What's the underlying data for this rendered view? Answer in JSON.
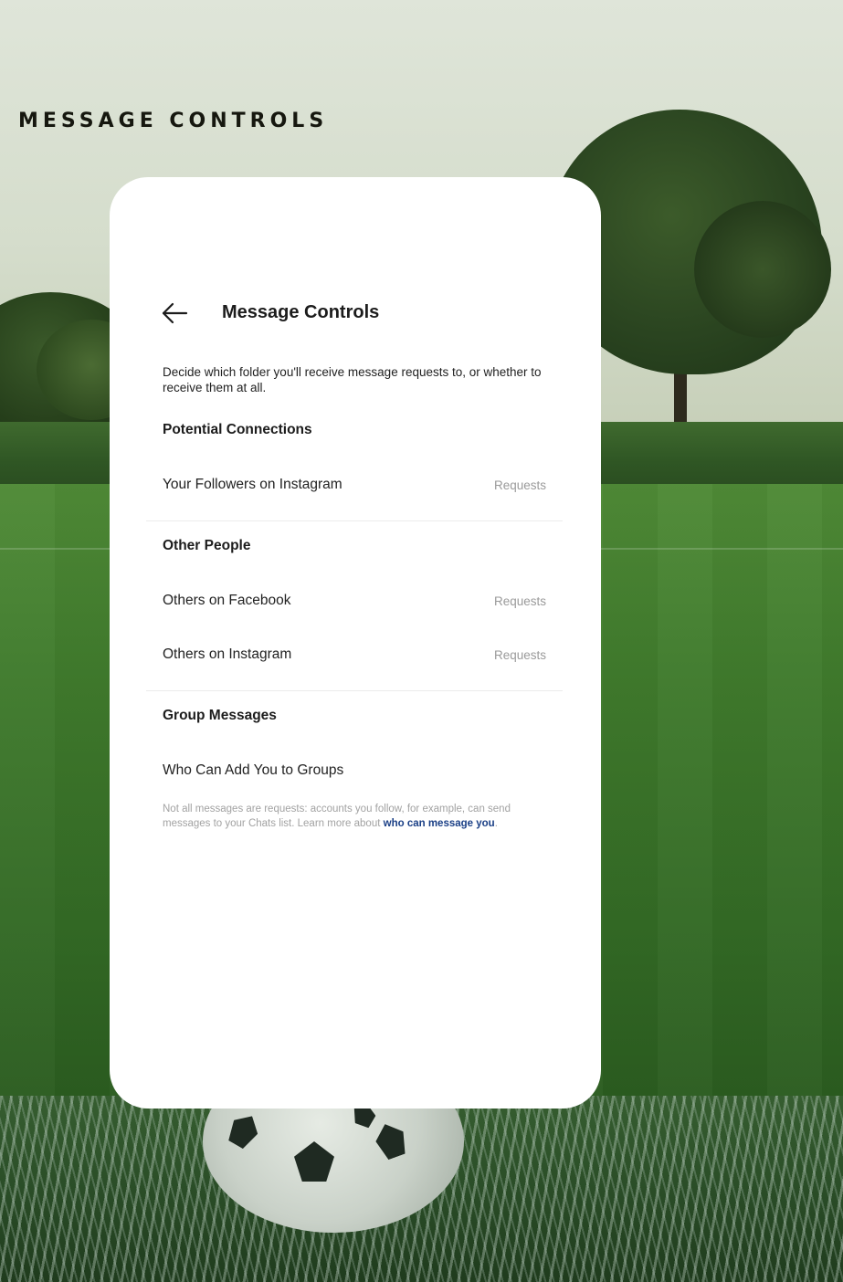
{
  "page_heading": "MESSAGE CONTROLS",
  "screen": {
    "back_icon": "arrow-left-icon",
    "title": "Message Controls",
    "description": "Decide which folder you'll receive message requests to, or whether to receive them at all.",
    "sections": [
      {
        "title": "Potential Connections",
        "items": [
          {
            "label": "Your Followers on Instagram",
            "value": "Requests"
          }
        ]
      },
      {
        "title": "Other People",
        "items": [
          {
            "label": "Others on Facebook",
            "value": "Requests"
          },
          {
            "label": "Others on Instagram",
            "value": "Requests"
          }
        ]
      },
      {
        "title": "Group Messages",
        "items": [
          {
            "label": "Who Can Add You to Groups",
            "value": ""
          }
        ]
      }
    ],
    "footnote": {
      "text": "Not all messages are requests: accounts you follow, for example, can send messages to your Chats list. Learn more about ",
      "link": "who can message you",
      "end": "."
    }
  },
  "colors": {
    "link": "#1a3f86",
    "card": "#ffffff",
    "muted": "#9a9a9a"
  }
}
